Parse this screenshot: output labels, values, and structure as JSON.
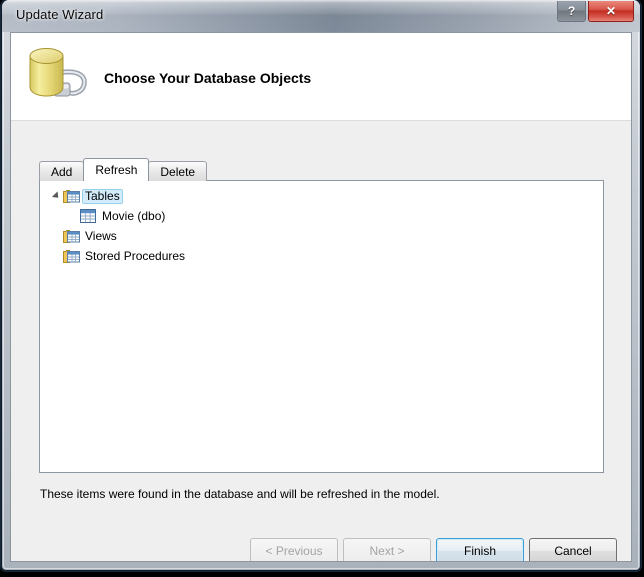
{
  "window": {
    "title": "Update Wizard",
    "caption_buttons": [
      {
        "name": "help-button",
        "glyph": "?",
        "label": "Help"
      },
      {
        "name": "close-button",
        "glyph": "✕",
        "label": "Close"
      }
    ]
  },
  "header": {
    "heading": "Choose Your Database Objects",
    "icon": "database-connection-icon"
  },
  "tabs": [
    {
      "label": "Add",
      "active": false,
      "name": "tab-add"
    },
    {
      "label": "Refresh",
      "active": true,
      "name": "tab-refresh"
    },
    {
      "label": "Delete",
      "active": false,
      "name": "tab-delete"
    }
  ],
  "tree": {
    "nodes": [
      {
        "label": "Tables",
        "icon": "tables-folder-icon",
        "expanded": true,
        "selected": true,
        "indent": 0,
        "children": [
          {
            "label": "Movie (dbo)",
            "icon": "table-icon",
            "expanded": false,
            "selected": false,
            "indent": 1,
            "children": []
          }
        ]
      },
      {
        "label": "Views",
        "icon": "views-folder-icon",
        "expanded": false,
        "selected": false,
        "indent": 0,
        "children": []
      },
      {
        "label": "Stored Procedures",
        "icon": "stored-procedures-folder-icon",
        "expanded": false,
        "selected": false,
        "indent": 0,
        "children": []
      }
    ]
  },
  "status": {
    "message": "These items were found in the database and will be refreshed in the model."
  },
  "buttons": [
    {
      "name": "previous-button",
      "label": "< Previous",
      "disabled": true,
      "default": false
    },
    {
      "name": "next-button",
      "label": "Next >",
      "disabled": true,
      "default": false
    },
    {
      "name": "finish-button",
      "label": "Finish",
      "disabled": false,
      "default": true
    },
    {
      "name": "cancel-button",
      "label": "Cancel",
      "disabled": false,
      "default": false
    }
  ],
  "colors": {
    "accent_focus": "#3c9fd6",
    "selection_fill": "#d3ecfb",
    "selection_border": "#98d1ef",
    "close_button": "#c22d22",
    "database_icon": "#e8d87a",
    "frame_border": "#18293b"
  }
}
